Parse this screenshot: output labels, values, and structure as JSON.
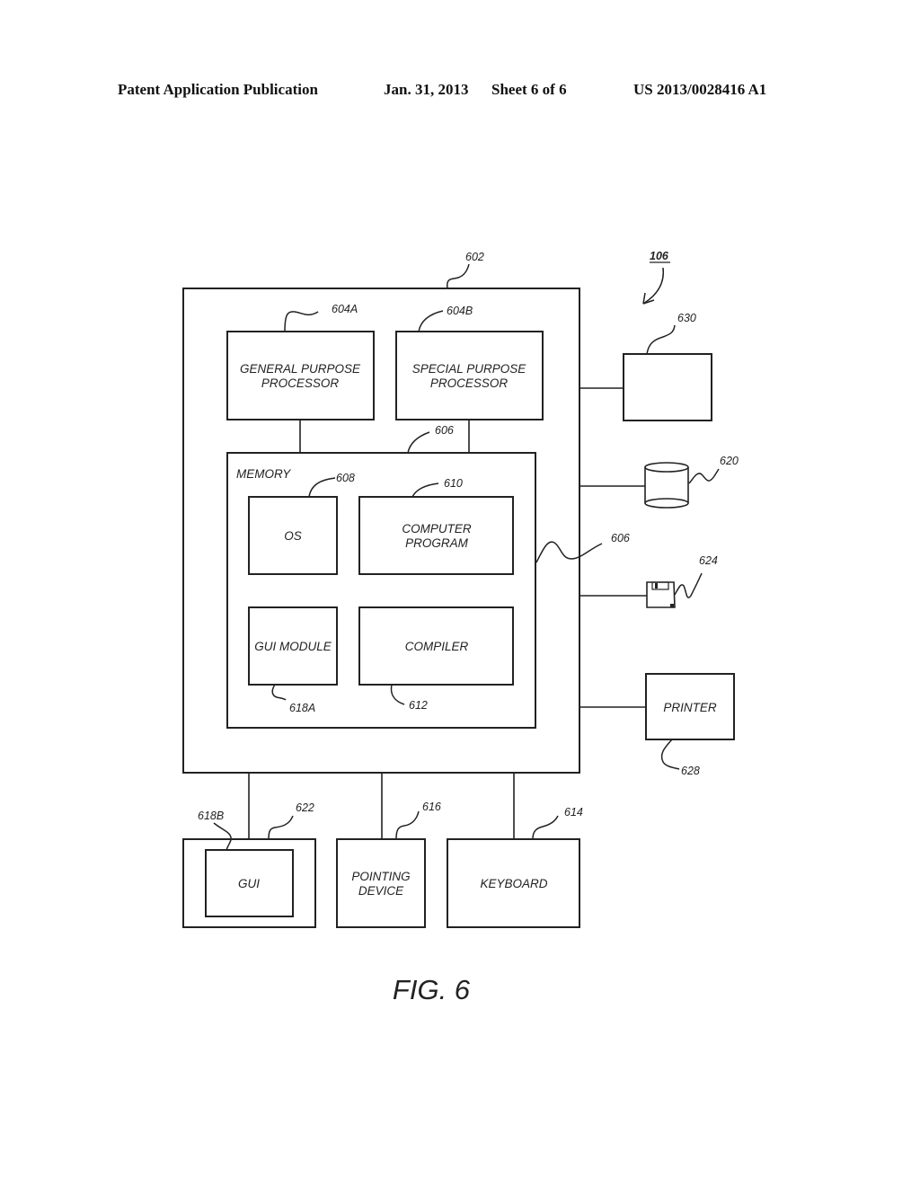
{
  "header": {
    "left": "Patent Application Publication",
    "date": "Jan. 31, 2013",
    "sheet": "Sheet 6 of 6",
    "number": "US 2013/0028416 A1"
  },
  "figure": {
    "caption": "FIG. 6",
    "system_ref": "106",
    "computer": {
      "ref": "602"
    },
    "general_processor": {
      "label_line1": "GENERAL PURPOSE",
      "label_line2": "PROCESSOR",
      "ref": "604A"
    },
    "special_processor": {
      "label_line1": "SPECIAL PURPOSE",
      "label_line2": "PROCESSOR",
      "ref": "604B"
    },
    "bus_ref_top": "606",
    "bus_ref_right": "606",
    "memory": {
      "label": "MEMORY",
      "os": {
        "label": "OS",
        "ref": "608"
      },
      "computer_program": {
        "label_line1": "COMPUTER",
        "label_line2": "PROGRAM",
        "ref": "610"
      },
      "gui_module": {
        "label": "GUI MODULE",
        "ref": "618A"
      },
      "compiler": {
        "label": "COMPILER",
        "ref": "612"
      }
    },
    "peripheral_630": {
      "ref": "630"
    },
    "storage_620": {
      "ref": "620"
    },
    "floppy_624": {
      "ref": "624"
    },
    "printer": {
      "label": "PRINTER",
      "ref": "628"
    },
    "display": {
      "ref": "622",
      "gui": {
        "label": "GUI",
        "ref": "618B"
      }
    },
    "pointing_device": {
      "label_line1": "POINTING",
      "label_line2": "DEVICE",
      "ref": "616"
    },
    "keyboard": {
      "label": "KEYBOARD",
      "ref": "614"
    }
  }
}
